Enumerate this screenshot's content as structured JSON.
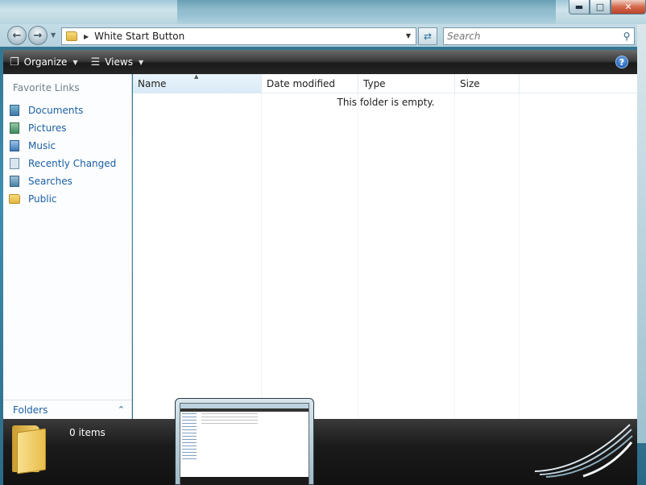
{
  "window": {
    "caption_buttons": {
      "minimize": "▬",
      "maximize": "□",
      "close": "✕"
    }
  },
  "address_bar": {
    "path_segment": "White Start Button",
    "icon": "folder-icon"
  },
  "search": {
    "placeholder": "Search",
    "value": ""
  },
  "toolbar": {
    "organize_label": "Organize",
    "views_label": "Views",
    "help_label": "?"
  },
  "nav_pane": {
    "heading": "Favorite Links",
    "items": [
      {
        "label": "Documents",
        "icon": "documents-icon"
      },
      {
        "label": "Pictures",
        "icon": "pictures-icon"
      },
      {
        "label": "Music",
        "icon": "music-icon"
      },
      {
        "label": "Recently Changed",
        "icon": "recently-changed-icon"
      },
      {
        "label": "Searches",
        "icon": "searches-icon"
      },
      {
        "label": "Public",
        "icon": "public-folder-icon"
      }
    ],
    "folders_label": "Folders"
  },
  "file_list": {
    "columns": [
      "Name",
      "Date modified",
      "Type",
      "Size"
    ],
    "empty_message": "This folder is empty."
  },
  "details_pane": {
    "item_count": "0 items"
  },
  "colors": {
    "link_blue": "#1b5fa5",
    "toolbar_dark": "#262626",
    "header_selected": "#d9ebf7"
  }
}
